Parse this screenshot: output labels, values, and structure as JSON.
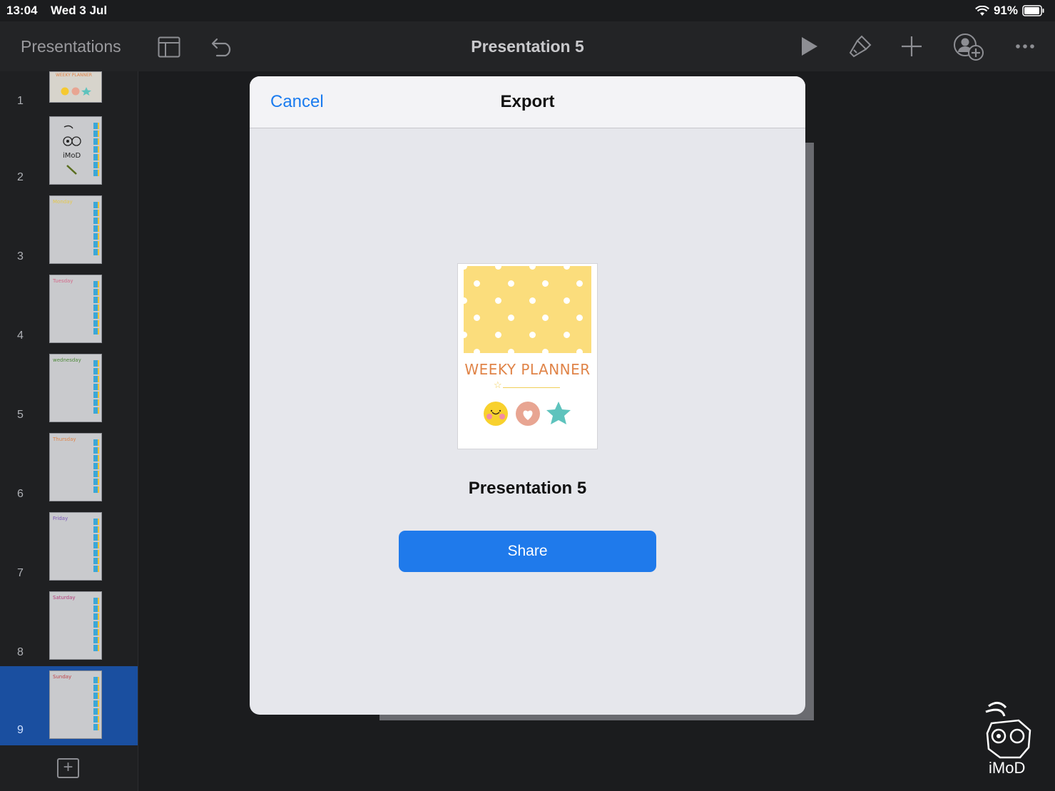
{
  "status_bar": {
    "time": "13:04",
    "date": "Wed 3 Jul",
    "battery": "91%"
  },
  "toolbar": {
    "back_label": "Presentations",
    "title": "Presentation 5",
    "icons": [
      "layout-icon",
      "undo-icon",
      "play-icon",
      "format-brush-icon",
      "add-icon",
      "collaborate-icon",
      "more-icon"
    ]
  },
  "sidebar": {
    "slides": [
      {
        "number": "1",
        "thumb_title": "WEEKY PLANNER"
      },
      {
        "number": "2",
        "thumb_title": "iMoD"
      },
      {
        "number": "3",
        "thumb_title": "Monday"
      },
      {
        "number": "4",
        "thumb_title": "Tuesday"
      },
      {
        "number": "5",
        "thumb_title": "wednesday"
      },
      {
        "number": "6",
        "thumb_title": "Thursday"
      },
      {
        "number": "7",
        "thumb_title": "Friday"
      },
      {
        "number": "8",
        "thumb_title": "Saturday"
      },
      {
        "number": "9",
        "thumb_title": "Sunday"
      }
    ],
    "selected_index": 8,
    "add_label": "+"
  },
  "dialog": {
    "cancel_label": "Cancel",
    "title": "Export",
    "preview_text": "WEEKY PLANNER",
    "file_name": "Presentation 5",
    "share_label": "Share"
  },
  "watermark": {
    "text": "iMoD"
  },
  "colors": {
    "accent": "#1f7aeb",
    "selected": "#1a4fa0",
    "planner_yellow": "#fbdd7c"
  }
}
